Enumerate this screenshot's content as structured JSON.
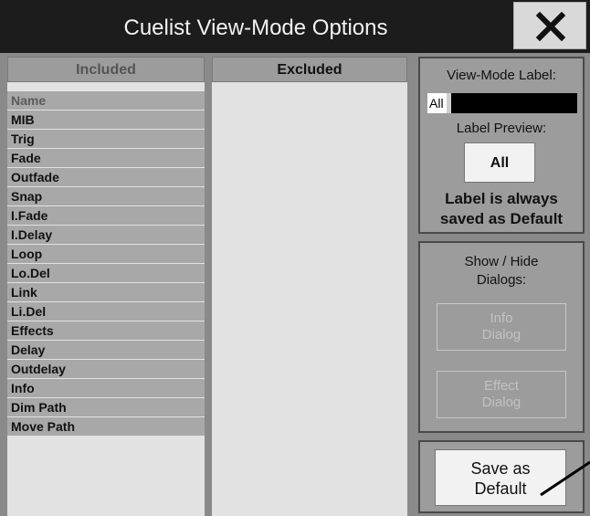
{
  "title": "Cuelist View-Mode Options",
  "columns": {
    "included_header": "Included",
    "excluded_header": "Excluded"
  },
  "included_items": [
    "Name",
    "MIB",
    "Trig",
    "Fade",
    "Outfade",
    "Snap",
    "I.Fade",
    "I.Delay",
    "Loop",
    "Lo.Del",
    "Link",
    "Li.Del",
    "Effects",
    "Delay",
    "Outdelay",
    "Info",
    "Dim Path",
    "Move Path"
  ],
  "excluded_items": [],
  "label_panel": {
    "heading": "View-Mode Label:",
    "value": "All",
    "preview_heading": "Label Preview:",
    "preview_value": "All",
    "note_line1": "Label is always",
    "note_line2": "saved as Default"
  },
  "dialogs_panel": {
    "heading_line1": "Show / Hide",
    "heading_line2": "Dialogs:",
    "info_line1": "Info",
    "info_line2": "Dialog",
    "effect_line1": "Effect",
    "effect_line2": "Dialog"
  },
  "save_panel": {
    "line1": "Save as",
    "line2": "Default"
  },
  "icons": {
    "close": "close-icon"
  },
  "colors": {
    "titlebar": "#1c1c1c",
    "background": "#8a8a8a",
    "list_item": "#a8a8a8"
  }
}
